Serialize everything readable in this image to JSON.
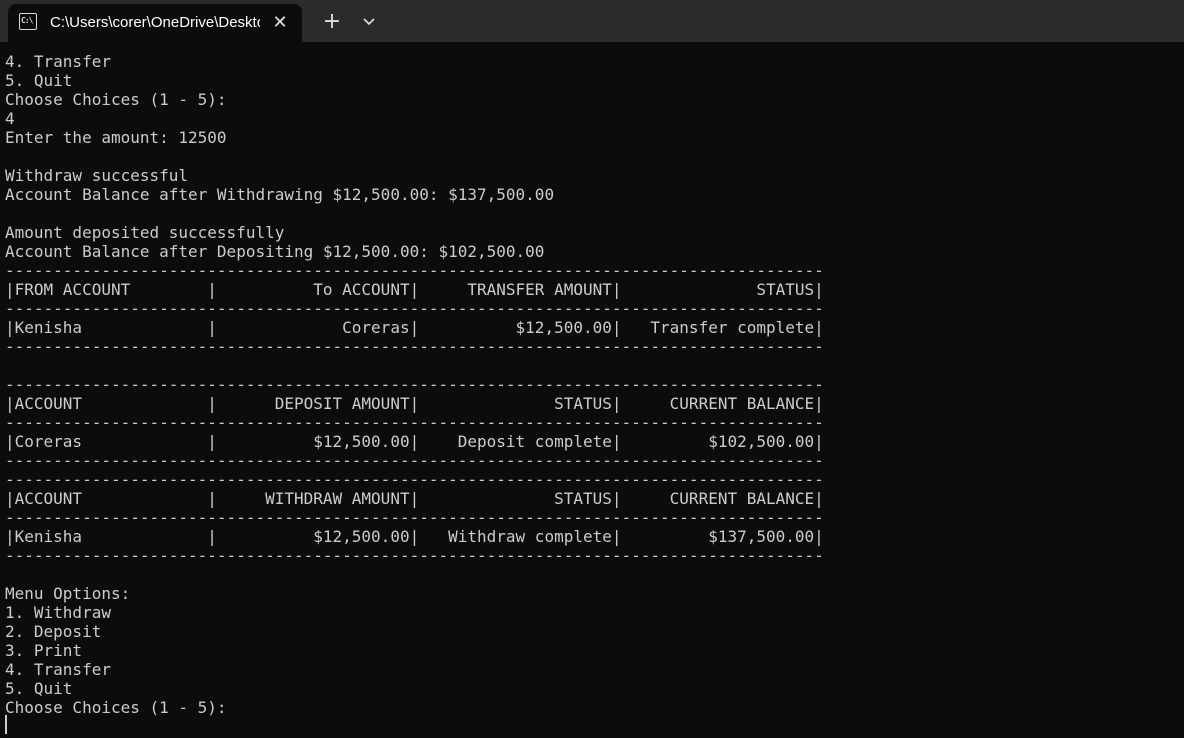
{
  "window": {
    "tab_title": "C:\\Users\\corer\\OneDrive\\Desktop",
    "tab_icon": "terminal-icon",
    "close_icon": "close-icon",
    "new_tab_icon": "plus-icon",
    "dropdown_icon": "chevron-down-icon",
    "background_color": "#0c0c0c",
    "text_color": "#cccccc"
  },
  "terminal": {
    "lines": [
      "4. Transfer",
      "5. Quit",
      "Choose Choices (1 - 5):",
      "4",
      "Enter the amount: 12500",
      "",
      "Withdraw successful",
      "Account Balance after Withdrawing $12,500.00: $137,500.00",
      "",
      "Amount deposited successfully",
      "Account Balance after Depositing $12,500.00: $102,500.00",
      "-------------------------------------------------------------------------------------",
      "|FROM ACCOUNT        |          To ACCOUNT|     TRANSFER AMOUNT|              STATUS|",
      "-------------------------------------------------------------------------------------",
      "|Kenisha             |             Coreras|          $12,500.00|   Transfer complete|",
      "-------------------------------------------------------------------------------------",
      "",
      "-------------------------------------------------------------------------------------",
      "|ACCOUNT             |      DEPOSIT AMOUNT|              STATUS|     CURRENT BALANCE|",
      "-------------------------------------------------------------------------------------",
      "|Coreras             |          $12,500.00|    Deposit complete|         $102,500.00|",
      "-------------------------------------------------------------------------------------",
      "-------------------------------------------------------------------------------------",
      "|ACCOUNT             |     WITHDRAW AMOUNT|              STATUS|     CURRENT BALANCE|",
      "-------------------------------------------------------------------------------------",
      "|Kenisha             |          $12,500.00|   Withdraw complete|         $137,500.00|",
      "-------------------------------------------------------------------------------------",
      "",
      "Menu Options:",
      "1. Withdraw",
      "2. Deposit",
      "3. Print",
      "4. Transfer",
      "5. Quit",
      "Choose Choices (1 - 5):"
    ]
  }
}
